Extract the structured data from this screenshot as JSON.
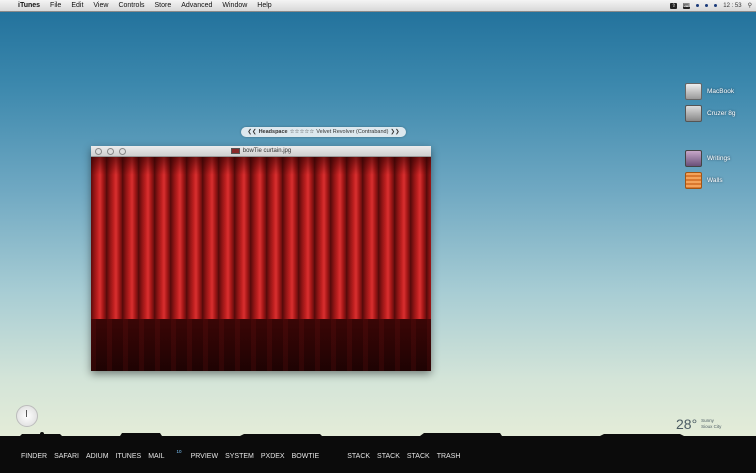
{
  "menubar": {
    "app": "iTunes",
    "menus": [
      "File",
      "Edit",
      "View",
      "Controls",
      "Store",
      "Advanced",
      "Window",
      "Help"
    ],
    "clock": "12 : 53"
  },
  "desktop_icons": [
    {
      "label": "MacBook",
      "icon": "hard-drive-icon"
    },
    {
      "label": "Cruzer 8g",
      "icon": "usb-drive-icon"
    },
    {
      "label": "Writings",
      "icon": "notebook-icon"
    },
    {
      "label": "Walls",
      "icon": "folder-icon"
    }
  ],
  "now_playing": {
    "prev": "❮❮",
    "artist": "Headspace",
    "stars": "☆☆☆☆☆",
    "track": "Velvet Revolver (Contraband)",
    "next": "❯❯"
  },
  "window": {
    "title": "bowTie curtain.jpg"
  },
  "weather": {
    "temp": "28°",
    "condition": "Sunny",
    "city": "Sioux City"
  },
  "dock": {
    "items": [
      "FINDER",
      "SAFARI",
      "ADIUM",
      "ITUNES",
      "MAIL",
      "PRVIEW",
      "SYSTEM",
      "PXDEX",
      "BOWTIE"
    ],
    "mail_badge": "10",
    "stacks": [
      "STACK",
      "STACK",
      "STACK",
      "TRASH"
    ]
  }
}
